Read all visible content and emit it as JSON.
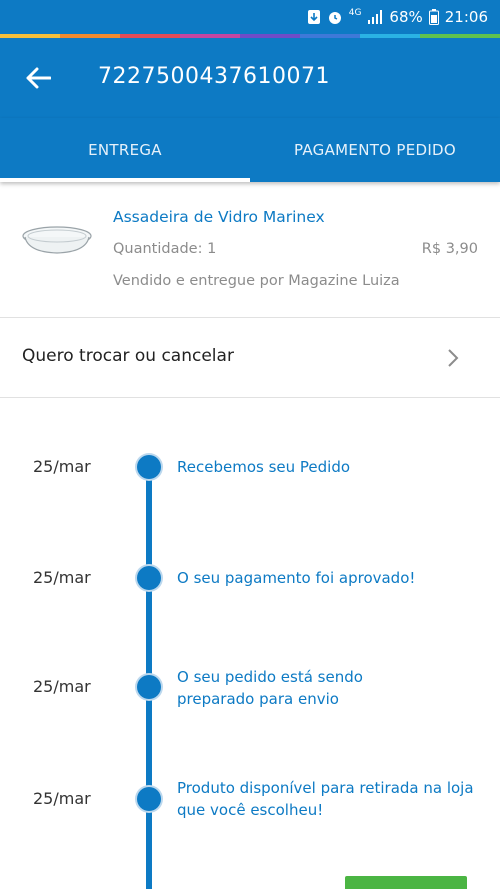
{
  "status_bar": {
    "battery": "68%",
    "time": "21:06",
    "network": "4G"
  },
  "app_bar": {
    "title": "7227500437610071",
    "back_icon": "arrow-back-icon"
  },
  "tabs": [
    {
      "label": "ENTREGA",
      "active": true
    },
    {
      "label": "PAGAMENTO PEDIDO",
      "active": false
    }
  ],
  "product": {
    "name": "Assadeira de Vidro Marinex",
    "quantity": "Quantidade: 1",
    "price": "R$ 3,90",
    "seller": "Vendido e entregue por Magazine Luiza"
  },
  "exchange": {
    "label": "Quero trocar ou cancelar"
  },
  "timeline": [
    {
      "date": "25/mar",
      "text": "Recebemos seu Pedido"
    },
    {
      "date": "25/mar",
      "text": "O seu pagamento foi aprovado!"
    },
    {
      "date": "25/mar",
      "text": "O seu pedido está sendo preparado para envio"
    },
    {
      "date": "25/mar",
      "text": "Produto disponível para retirada na loja que você escolheu!"
    }
  ],
  "colors": {
    "primary": "#0d7ac4",
    "accent_green": "#4bb543"
  }
}
